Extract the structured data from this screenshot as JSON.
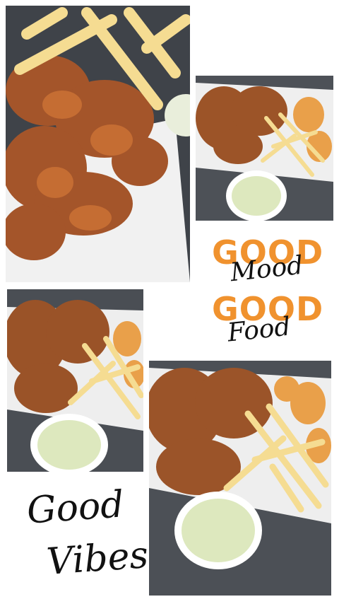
{
  "slogan": {
    "line1": "GOOD",
    "line2": "Mood",
    "line3": "GOOD",
    "line4": "Food"
  },
  "vibes": {
    "line1": "Good",
    "line2": "Vibes"
  },
  "colors": {
    "accent_orange": "#f0922e",
    "script_black": "#111111",
    "table_grey": "#4b4f55",
    "chicken_brown": "#a85a2a",
    "fries_yellow": "#f3d98a",
    "sauce_green": "#dfe9c4"
  }
}
